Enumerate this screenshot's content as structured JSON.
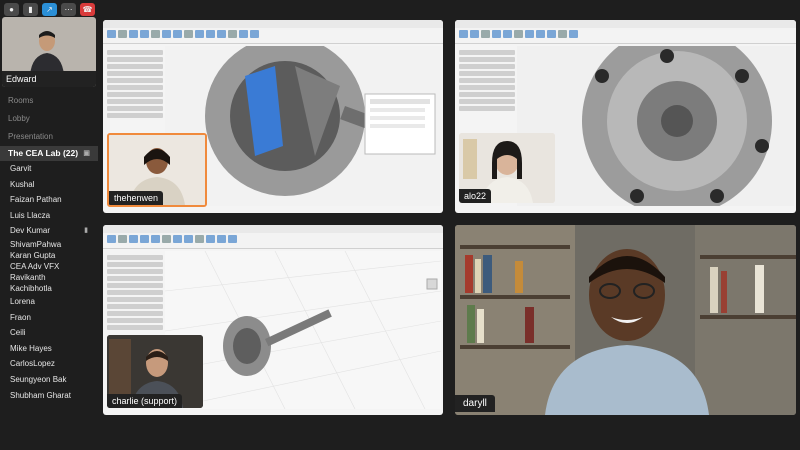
{
  "toolbar": {
    "mic_icon": "mic-icon",
    "camera_icon": "camera-icon",
    "share_icon": "share-icon",
    "more_icon": "more-icon",
    "hangup_icon": "hangup-icon"
  },
  "self_view": {
    "name": "Edward"
  },
  "sidebar": {
    "section_rooms": "Rooms",
    "section_lobby": "Lobby",
    "section_presentation": "Presentation",
    "active_room": "The CEA Lab (22)",
    "members": [
      "Garvit",
      "Kushal",
      "Faizan Pathan",
      "Luis Llacza",
      "Dev Kumar",
      "ShivamPahwa",
      "Karan Gupta",
      "CEA Adv VFX",
      "Ravikanth",
      "Kachibhotla",
      "Lorena",
      "Fraon",
      "Ceili",
      "Mike Hayes",
      "CarlosLopez",
      "Seungyeon Bak",
      "Shubham Gharat"
    ]
  },
  "tiles": {
    "tile1": {
      "thumb_name": "thehenwen"
    },
    "tile2": {
      "thumb_name": "alo22"
    },
    "tile3": {
      "thumb_name": "charlie (support)"
    },
    "tile4": {
      "name": "daryll"
    }
  },
  "colors": {
    "background": "#1e1e1e",
    "active_speaker": "#f08a3c",
    "accent": "#2b8fd6",
    "hangup": "#d93b3b"
  }
}
